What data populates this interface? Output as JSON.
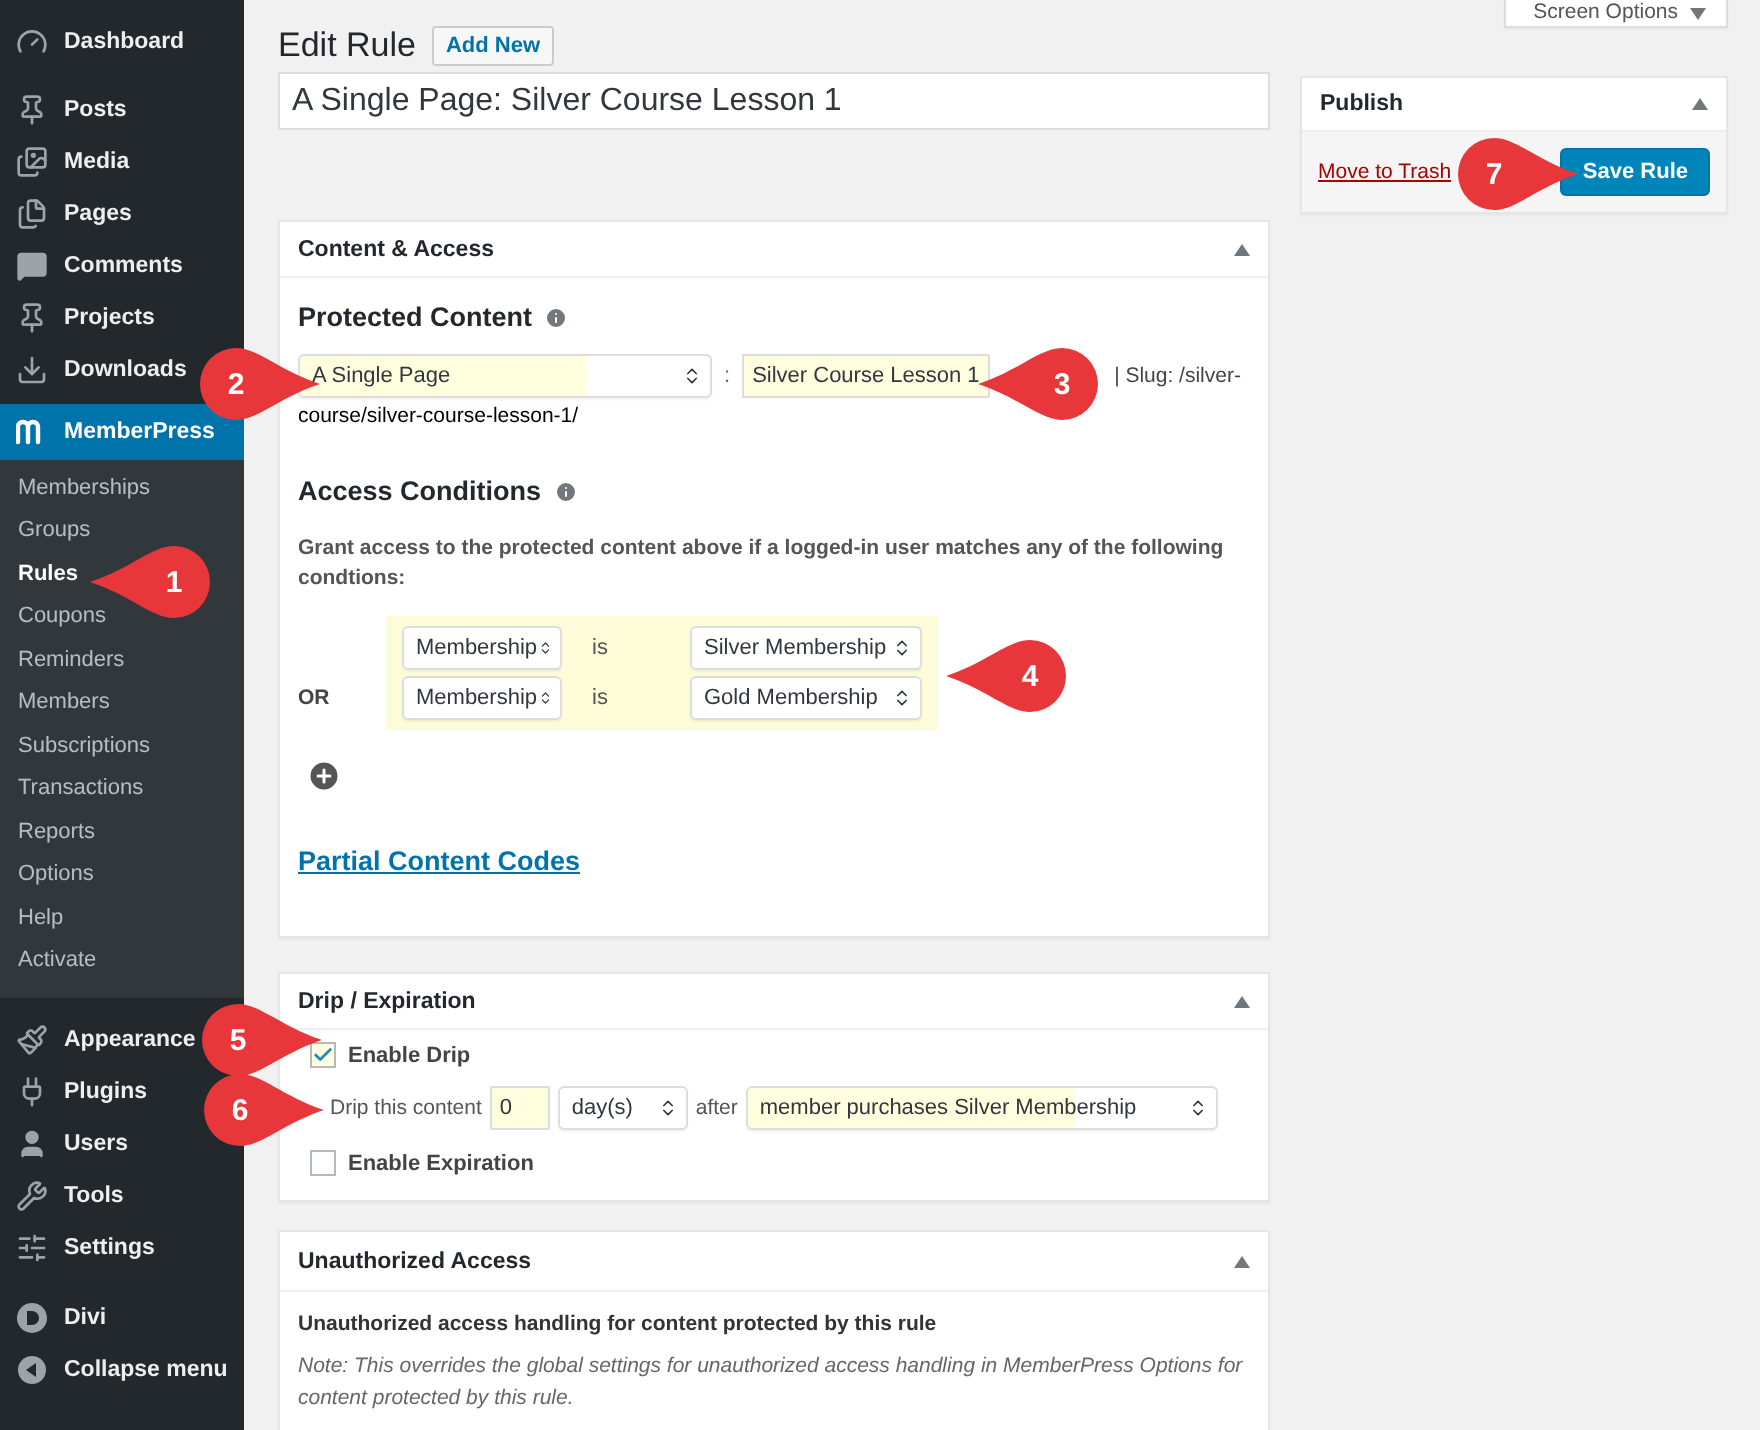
{
  "sidebar": {
    "items": [
      {
        "label": "Dashboard",
        "selected": false
      },
      {
        "label": "Posts",
        "selected": false
      },
      {
        "label": "Media",
        "selected": false
      },
      {
        "label": "Pages",
        "selected": false
      },
      {
        "label": "Comments",
        "selected": false
      },
      {
        "label": "Projects",
        "selected": false
      },
      {
        "label": "Downloads",
        "selected": false
      },
      {
        "label": "MemberPress",
        "selected": true,
        "children": [
          {
            "label": "Memberships",
            "selected": false
          },
          {
            "label": "Groups",
            "selected": false
          },
          {
            "label": "Rules",
            "selected": true
          },
          {
            "label": "Coupons",
            "selected": false
          },
          {
            "label": "Reminders",
            "selected": false
          },
          {
            "label": "Members",
            "selected": false
          },
          {
            "label": "Subscriptions",
            "selected": false
          },
          {
            "label": "Transactions",
            "selected": false
          },
          {
            "label": "Reports",
            "selected": false
          },
          {
            "label": "Options",
            "selected": false
          },
          {
            "label": "Help",
            "selected": false
          },
          {
            "label": "Activate",
            "selected": false
          }
        ]
      },
      {
        "label": "Appearance",
        "selected": false
      },
      {
        "label": "Plugins",
        "selected": false
      },
      {
        "label": "Users",
        "selected": false
      },
      {
        "label": "Tools",
        "selected": false
      },
      {
        "label": "Settings",
        "selected": false
      },
      {
        "label": "Divi",
        "selected": false
      },
      {
        "label": "Collapse menu",
        "selected": false
      }
    ]
  },
  "screen_options": "Screen Options",
  "page_title": "Edit Rule",
  "add_new_button": "Add New",
  "title_field": {
    "value": "A Single Page: Silver Course Lesson 1"
  },
  "content_access": {
    "title": "Content & Access",
    "protected_heading": "Protected Content",
    "type_select": "A Single Page",
    "separator": ":",
    "content_field": "Silver Course Lesson 1",
    "slug_lines": [
      "| Slug: /silver-",
      "course/silver-course-lesson-1/"
    ],
    "access_heading": "Access Conditions",
    "description": "Grant access to the protected content above if a logged-in user matches any of the following condtions:",
    "conditions": [
      {
        "field": "Membership",
        "operator": "is",
        "value": "Silver Membership"
      },
      {
        "prefix": "OR",
        "field": "Membership",
        "operator": "is",
        "value": "Gold Membership"
      }
    ],
    "partial_link": "Partial Content Codes"
  },
  "drip": {
    "title": "Drip / Expiration",
    "enable_drip": {
      "label": "Enable Drip",
      "checked": true
    },
    "drip_label": "Drip this content",
    "amount": "0",
    "unit": "day(s)",
    "after": "after",
    "trigger": "member purchases Silver Membership",
    "enable_expiration": {
      "label": "Enable Expiration",
      "checked": false
    }
  },
  "unauthorized": {
    "title": "Unauthorized Access",
    "heading": "Unauthorized access handling for content protected by this rule",
    "note": "Note: This overrides the global settings for unauthorized access handling in MemberPress Options for content protected by this rule."
  },
  "publish": {
    "title": "Publish",
    "trash_link": "Move to Trash",
    "save_button": "Save Rule"
  },
  "callouts": [
    {
      "number": "1"
    },
    {
      "number": "2"
    },
    {
      "number": "3"
    },
    {
      "number": "4"
    },
    {
      "number": "5"
    },
    {
      "number": "6"
    },
    {
      "number": "7"
    }
  ]
}
